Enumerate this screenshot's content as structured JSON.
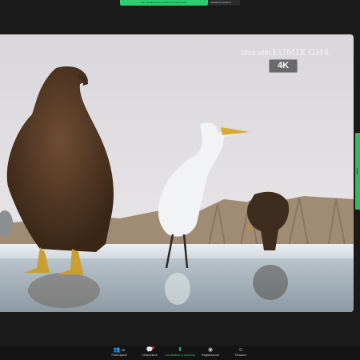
{
  "banner": {
    "sharing_text": "Sei visualizzando lo schermo di Shir Ferrie",
    "view_options": "Visualizza opzioni ▾"
  },
  "video": {
    "watermark_prefix": "Shot with",
    "watermark_brand": "LUMIX",
    "watermark_model": "GH4",
    "badge": "4K"
  },
  "toolbar": {
    "items": [
      {
        "label": "Partecipanti",
        "icon": "participants-icon",
        "count": "90"
      },
      {
        "label": "Chiacchiera",
        "icon": "chat-icon"
      },
      {
        "label": "Condividere lo schermo",
        "icon": "share-screen-icon"
      },
      {
        "label": "Registrazione",
        "icon": "record-icon"
      },
      {
        "label": "Reazioni",
        "icon": "reactions-icon"
      }
    ]
  },
  "colors": {
    "accent": "#2ecc71",
    "background": "#1a1a1a",
    "notification": "#e53935"
  }
}
